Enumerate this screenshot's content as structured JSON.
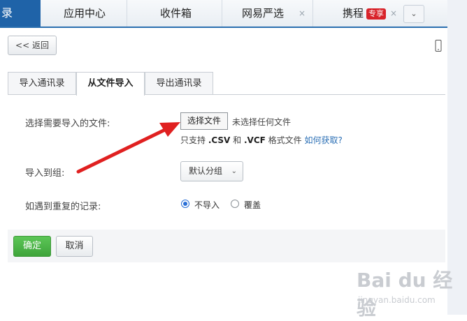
{
  "top_tabs": {
    "first": "录",
    "items": [
      {
        "label": "应用中心",
        "closable": false
      },
      {
        "label": "收件箱",
        "closable": false
      },
      {
        "label": "网易严选",
        "closable": true
      },
      {
        "label": "携程",
        "tag": "专享",
        "closable": true
      }
    ],
    "close_glyph": "×",
    "more_glyph": "⌄"
  },
  "back_button": "<< 返回",
  "content_tabs": [
    {
      "label": "导入通讯录",
      "active": false
    },
    {
      "label": "从文件导入",
      "active": true
    },
    {
      "label": "导出通讯录",
      "active": false
    }
  ],
  "form": {
    "file_label": "选择需要导入的文件:",
    "choose_button": "选择文件",
    "no_file": "未选择任何文件",
    "hint_prefix": "只支持 ",
    "hint_csv": ".CSV",
    "hint_and": " 和 ",
    "hint_vcf": ".VCF",
    "hint_suffix": " 格式文件 ",
    "hint_link": "如何获取?",
    "group_label": "导入到组:",
    "group_value": "默认分组",
    "dup_label": "如遇到重复的记录:",
    "dup_options": [
      {
        "label": "不导入",
        "selected": true
      },
      {
        "label": "覆盖",
        "selected": false
      }
    ]
  },
  "buttons": {
    "ok": "确定",
    "cancel": "取消"
  },
  "watermark": {
    "main": "Bai du 经验",
    "sub": "jingyan.baidu.com"
  },
  "colors": {
    "accent": "#1f63a8",
    "ok_green": "#4cb848",
    "arrow_red": "#e02020"
  }
}
